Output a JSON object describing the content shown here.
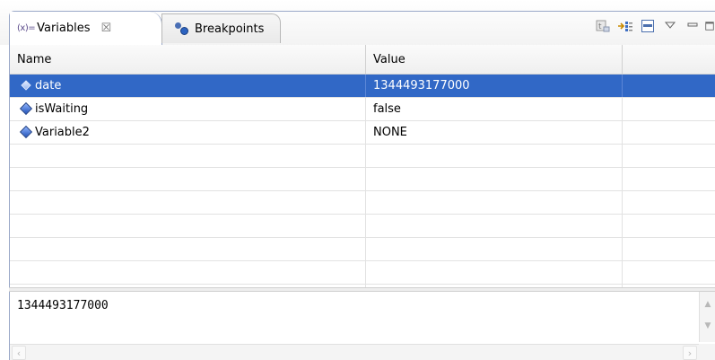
{
  "tabs": {
    "variables": {
      "icon_text": "(x)=",
      "label": "Variables",
      "close": "☒"
    },
    "breakpoints": {
      "label": "Breakpoints"
    }
  },
  "toolbar": {
    "icons": [
      "show-type-names-icon",
      "collapse-all-icon",
      "layout-icon",
      "view-menu-icon",
      "minimize-icon"
    ]
  },
  "table": {
    "columns": [
      "Name",
      "Value",
      ""
    ],
    "rows": [
      {
        "name": "date",
        "value": "1344493177000",
        "selected": true
      },
      {
        "name": "isWaiting",
        "value": "false",
        "selected": false
      },
      {
        "name": "Variable2",
        "value": "NONE",
        "selected": false
      }
    ]
  },
  "detail": {
    "text": "1344493177000"
  },
  "colors": {
    "selection": "#3168c6",
    "border": "#9aa8c8"
  }
}
